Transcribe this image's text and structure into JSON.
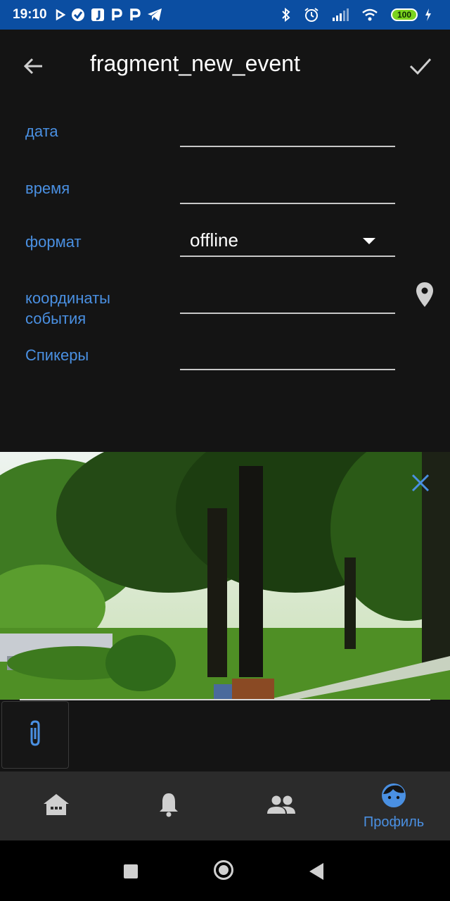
{
  "status_bar": {
    "time": "19:10",
    "battery": "100",
    "icons": [
      "cast-icon",
      "check-icon",
      "j-icon",
      "p-icon",
      "p-icon",
      "telegram-icon",
      "bluetooth-icon",
      "alarm-icon",
      "signal-icon",
      "wifi-icon",
      "charging-icon"
    ]
  },
  "app_bar": {
    "title": "fragment_new_event",
    "back_icon": "arrow-left-icon",
    "confirm_icon": "check-icon"
  },
  "form": {
    "date_label": "дата",
    "time_label": "время",
    "format_label": "формат",
    "format_value": "offline",
    "coords_label_line1": "координаты",
    "coords_label_line2": "события",
    "speakers_label": "Спикеры"
  },
  "bottom_nav": {
    "items": [
      {
        "icon": "home-icon",
        "label": ""
      },
      {
        "icon": "bell-icon",
        "label": ""
      },
      {
        "icon": "people-icon",
        "label": ""
      },
      {
        "icon": "profile-face-icon",
        "label": "Профиль"
      }
    ]
  },
  "colors": {
    "accent": "#4a90e2",
    "status_bar": "#0b4ea2",
    "background": "#141414",
    "nav_background": "#2b2b2b"
  }
}
